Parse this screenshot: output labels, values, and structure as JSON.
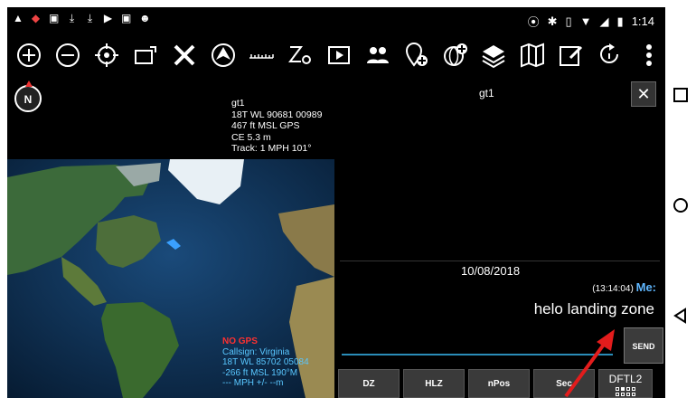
{
  "status": {
    "time": "1:14"
  },
  "toolbar": {
    "icons": [
      "zoom-in",
      "zoom-out",
      "locate",
      "lock-rotate",
      "cross",
      "nav-arrow",
      "ruler",
      "route",
      "video",
      "team",
      "add-point",
      "add-overlay",
      "layers",
      "map",
      "edit",
      "rotate",
      "overflow-menu"
    ]
  },
  "map": {
    "compass_label": "N",
    "info": {
      "name": "gt1",
      "grid": "18T WL 90681 00989",
      "elevation": "467 ft MSL GPS",
      "ce": "CE 5.3 m",
      "track": "Track: 1 MPH   101°"
    },
    "self": {
      "gps_status": "NO GPS",
      "callsign": "Callsign: Virginia",
      "grid": "18T  WL  85702  05084",
      "elevation": "-266 ft MSL          190°M",
      "speed": "--- MPH             +/- --m"
    },
    "colors": {
      "ocean": "#0d2b4d",
      "land": "#3c6a3a",
      "ice": "#e8f0f5"
    }
  },
  "chat": {
    "title": "gt1",
    "close_label": "✕",
    "date": "10/08/2018",
    "message_time": "(13:14:04)",
    "message_sender": "Me:",
    "message_text": "helo landing zone",
    "send_label": "SEND",
    "quick_buttons": [
      "DZ",
      "HLZ",
      "nPos",
      "Sec"
    ],
    "dftl_label": "DFTL2"
  }
}
